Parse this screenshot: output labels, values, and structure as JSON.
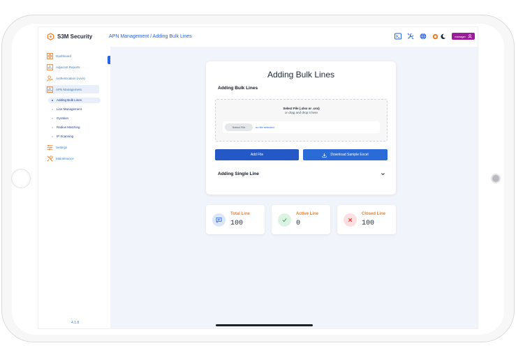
{
  "app": {
    "name": "S3M Security",
    "version": "4.1.8"
  },
  "header": {
    "breadcrumb": "APN Management / Adding Bulk Lines",
    "user_label": "manager"
  },
  "sidebar": {
    "items": [
      {
        "label": "Dashboard",
        "icon": "grid-icon"
      },
      {
        "label": "Adjacent Reports",
        "icon": "report-icon"
      },
      {
        "label": "Authentication (AAA)",
        "icon": "user-key-icon"
      },
      {
        "label": "APN Management",
        "icon": "report-icon"
      },
      {
        "label": "Settings",
        "icon": "sliders-icon"
      },
      {
        "label": "Maintenance",
        "icon": "wrench-icon"
      }
    ],
    "sub_items": [
      "Adding Bulk Lines",
      "Line Management",
      "Gyration",
      "Radius Matching",
      "IP Scanning"
    ]
  },
  "main": {
    "title": "Adding Bulk Lines",
    "bulk_section": "Adding Bulk Lines",
    "dropzone": {
      "title": "Select File (.xlsx or .csv)",
      "subtitle": "or drag and drop it here",
      "file_button": "Select File",
      "file_status": "no file selected"
    },
    "add_button": "Add File",
    "download_button": "Download Sample Excel",
    "single_section": "Adding Single Line"
  },
  "stats": [
    {
      "label": "Total Line",
      "value": "100",
      "icon": "chat-icon",
      "color": "#2563eb"
    },
    {
      "label": "Active Line",
      "value": "0",
      "icon": "check-icon",
      "color": "#16a34a"
    },
    {
      "label": "Closed Line",
      "value": "100",
      "icon": "close-icon",
      "color": "#dc2626"
    }
  ],
  "colors": {
    "accent": "#2563eb",
    "user_badge": "#9b1b9b",
    "stat_label": "#f07d28"
  }
}
